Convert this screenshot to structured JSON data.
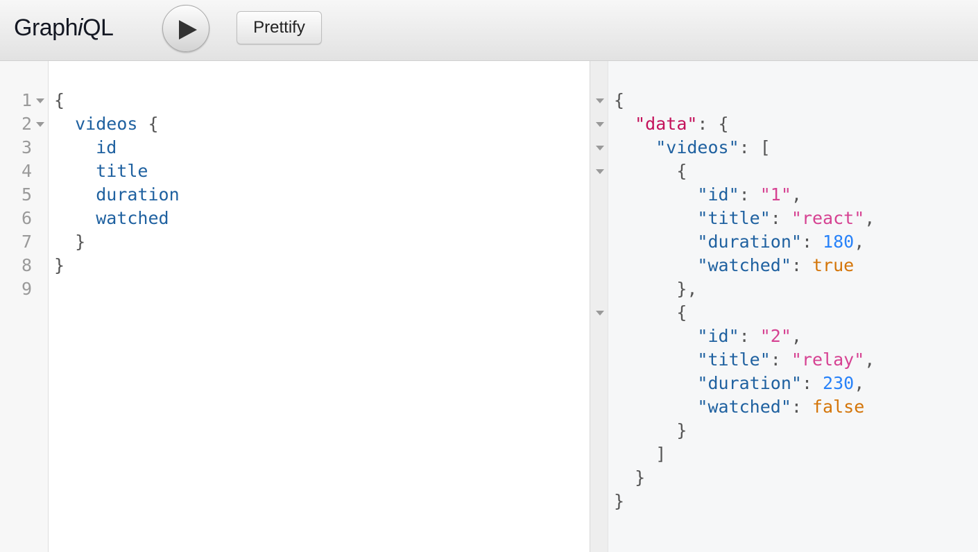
{
  "toolbar": {
    "brand_prefix": "Graph",
    "brand_italic": "i",
    "brand_suffix": "QL",
    "run_icon": "play-icon",
    "prettify_label": "Prettify"
  },
  "query_editor": {
    "line_numbers": [
      "1",
      "2",
      "3",
      "4",
      "5",
      "6",
      "7",
      "8",
      "9"
    ],
    "lines": {
      "l1": "{",
      "l2_field": "videos",
      "l2_brace": " {",
      "l3": "id",
      "l4": "title",
      "l5": "duration",
      "l6": "watched",
      "l7": "}",
      "l8": "}"
    }
  },
  "result_viewer": {
    "root_open": "{",
    "data_key": "\"data\"",
    "data_open": ": {",
    "videos_key": "\"videos\"",
    "videos_open": ": [",
    "item_open": "{",
    "items": [
      {
        "id_key": "\"id\"",
        "id_val": "\"1\"",
        "title_key": "\"title\"",
        "title_val": "\"react\"",
        "duration_key": "\"duration\"",
        "duration_val": "180",
        "watched_key": "\"watched\"",
        "watched_val": "true",
        "close": "},"
      },
      {
        "id_key": "\"id\"",
        "id_val": "\"2\"",
        "title_key": "\"title\"",
        "title_val": "\"relay\"",
        "duration_key": "\"duration\"",
        "duration_val": "230",
        "watched_key": "\"watched\"",
        "watched_val": "false",
        "close": "}"
      }
    ],
    "array_close": "]",
    "data_close": "}",
    "root_close": "}",
    "colon": ": ",
    "comma": ","
  },
  "colors": {
    "field": "#1f61a0",
    "root_key": "#c4125b",
    "string": "#d64292",
    "number": "#2882f9",
    "boolean": "#d47509"
  }
}
